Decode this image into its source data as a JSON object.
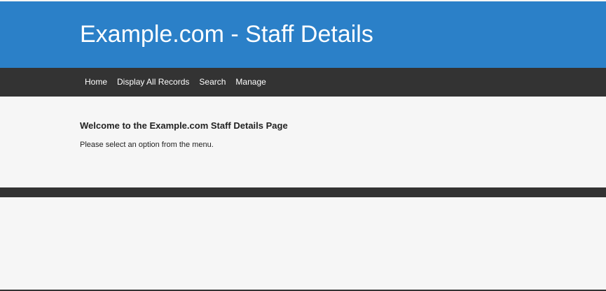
{
  "header": {
    "title": "Example.com - Staff Details"
  },
  "nav": {
    "items": [
      {
        "label": "Home"
      },
      {
        "label": "Display All Records"
      },
      {
        "label": "Search"
      },
      {
        "label": "Manage"
      }
    ]
  },
  "main": {
    "heading": "Welcome to the Example.com Staff Details Page",
    "text": "Please select an option from the menu."
  },
  "colors": {
    "header_bg": "#2b80c8",
    "nav_bg": "#333333",
    "page_bg": "#f6f6f6"
  }
}
